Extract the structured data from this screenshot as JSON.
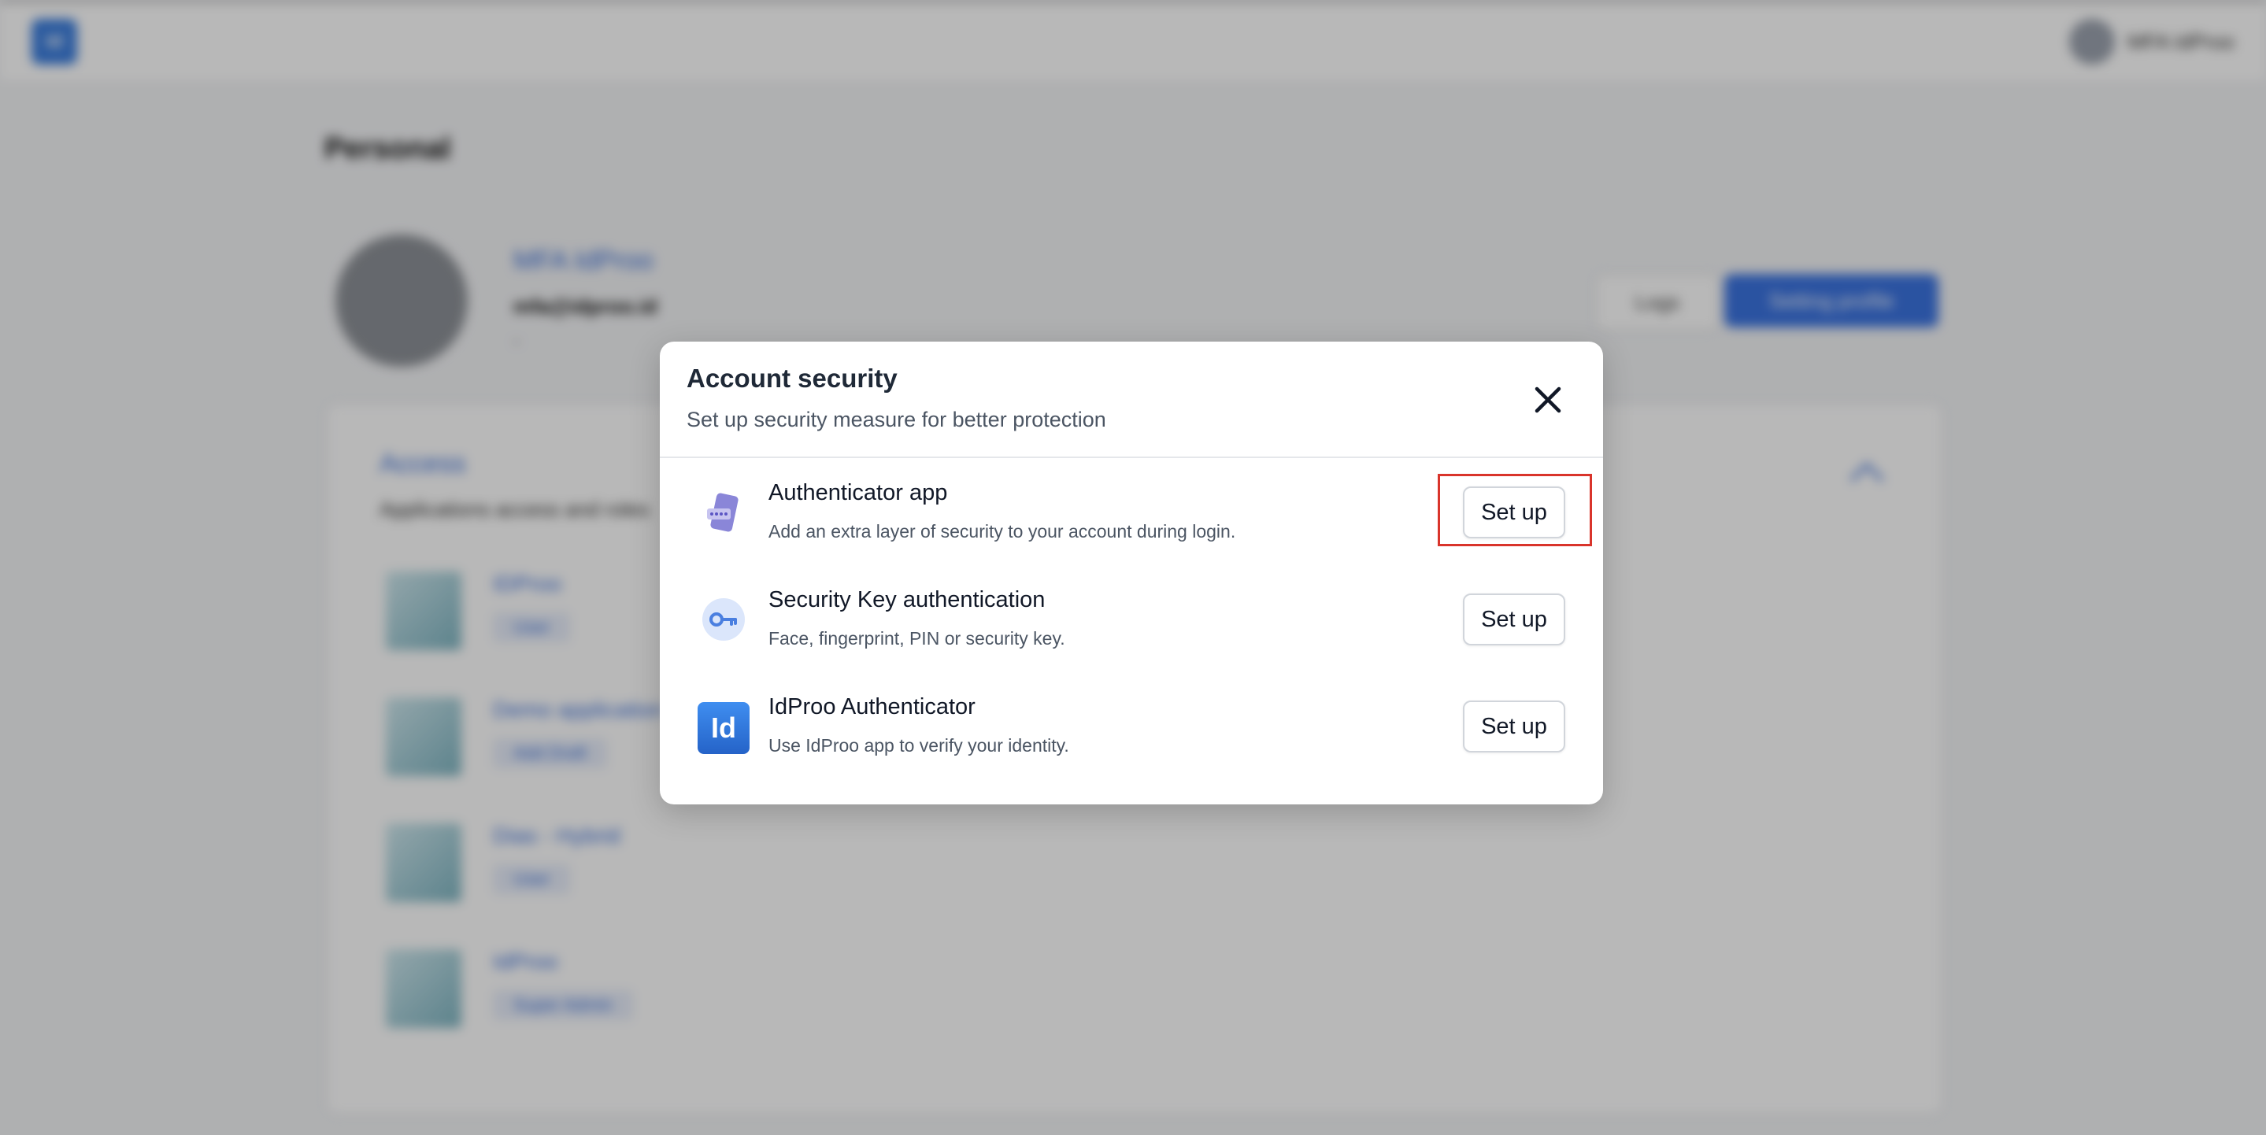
{
  "background": {
    "app_logo_text": "Id",
    "top_user_name": "MFA IdProo",
    "page_title": "Personal",
    "profile": {
      "name": "MFA IdProo",
      "email": "mfa@idproo.id",
      "extra": "-"
    },
    "buttons": {
      "logs": "Logs",
      "setting_profile": "Setting profile"
    },
    "access": {
      "title": "Access",
      "subtitle": "Applications access and roles",
      "apps": [
        {
          "name": "IDProo",
          "role": "User"
        },
        {
          "name": "Demo application",
          "role": "Add Draft"
        },
        {
          "name": "Dias - Hybrid",
          "role": "User"
        },
        {
          "name": "IdProo",
          "role": "Super Admin"
        }
      ]
    }
  },
  "modal": {
    "title": "Account security",
    "subtitle": "Set up security measure for better protection",
    "close_icon": "close-icon",
    "options": [
      {
        "icon": "authenticator-phone-icon",
        "title": "Authenticator app",
        "description": "Add an extra layer of security to your account during login.",
        "button_label": "Set up"
      },
      {
        "icon": "security-key-icon",
        "title": "Security Key authentication",
        "description": "Face, fingerprint, PIN or security key.",
        "button_label": "Set up"
      },
      {
        "icon": "idproo-logo-icon",
        "icon_text": "Id",
        "title": "IdProo Authenticator",
        "description": "Use IdProo app to verify your identity.",
        "button_label": "Set up"
      }
    ]
  },
  "colors": {
    "accent": "#3b73e0",
    "highlight": "#d9342b",
    "overlay": "rgba(0,0,0,0.28)"
  }
}
